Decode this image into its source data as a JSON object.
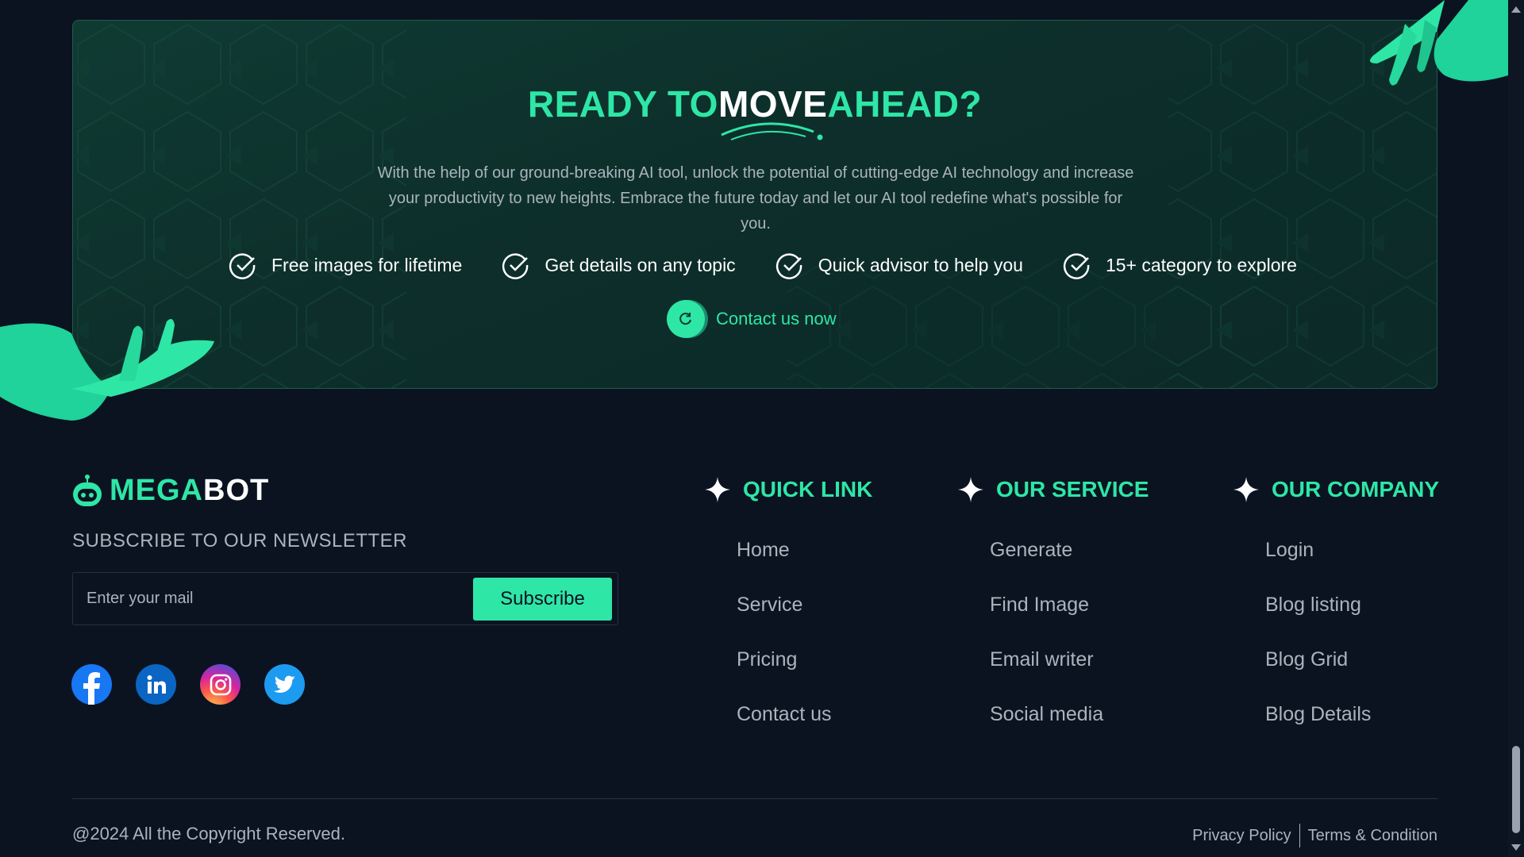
{
  "cta": {
    "title_part1": "READY TO",
    "title_part2": "MOVE",
    "title_part3": "AHEAD?",
    "description": "With the help of our ground-breaking AI tool, unlock the potential of cutting-edge AI technology and increase your productivity to new heights. Embrace the future today and let our AI tool redefine what's possible for you.",
    "features": [
      "Free images for lifetime",
      "Get details on any topic",
      "Quick advisor to help you",
      "15+ category to explore"
    ],
    "contact_label": "Contact us now"
  },
  "footer": {
    "logo_part1": "MEGA",
    "logo_part2": "BOT",
    "newsletter_title": "SUBSCRIBE TO OUR NEWSLETTER",
    "email_placeholder": "Enter your mail",
    "subscribe_label": "Subscribe",
    "socials": [
      "facebook-icon",
      "linkedin-icon",
      "instagram-icon",
      "twitter-icon"
    ],
    "columns": [
      {
        "title": "QUICK LINK",
        "items": [
          "Home",
          "Service",
          "Pricing",
          "Contact us"
        ]
      },
      {
        "title": "OUR SERVICE",
        "items": [
          "Generate",
          "Find Image",
          "Email writer",
          "Social media"
        ]
      },
      {
        "title": "OUR COMPANY",
        "items": [
          "Login",
          "Blog listing",
          "Blog Grid",
          "Blog Details"
        ]
      }
    ],
    "copyright": "@2024 All the Copyright Reserved.",
    "privacy_label": "Privacy Policy",
    "terms_label": "Terms & Condition"
  },
  "colors": {
    "accent": "#2ee6a6",
    "background": "#0b1321",
    "muted_text": "#aab4bb"
  }
}
